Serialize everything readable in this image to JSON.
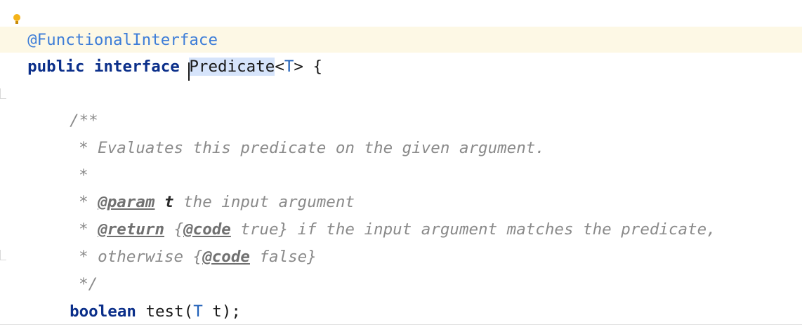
{
  "editor": {
    "annotation": "@FunctionalInterface",
    "decl": {
      "kw_public": "public",
      "kw_interface": "interface",
      "name": "Predicate",
      "generic": "<T>",
      "brace": "{"
    },
    "doc": {
      "open": "/**",
      "l1": "* Evaluates this predicate on the given argument.",
      "l2": "*",
      "l3_star": "*",
      "l3_tag": "@param",
      "l3_name": "t",
      "l3_text": "the input argument",
      "l4_star": "*",
      "l4_tag": "@return",
      "l4_brace_open": "{",
      "l4_code": "@code",
      "l4_text": "true} if the input argument matches the predicate,",
      "l5_text_a": "* otherwise {",
      "l5_code": "@code",
      "l5_text_b": "false}",
      "close": "*/"
    },
    "method": {
      "kw_boolean": "boolean",
      "name_open": "test(",
      "param_type": "T",
      "param_rest": "t);"
    }
  },
  "colors": {
    "annotation": "#3d7dd8",
    "keyword": "#0b2f8a",
    "doc_comment": "#8a8a8a",
    "selection": "#d6e4fb",
    "caret_line": "#fdf8e5"
  }
}
